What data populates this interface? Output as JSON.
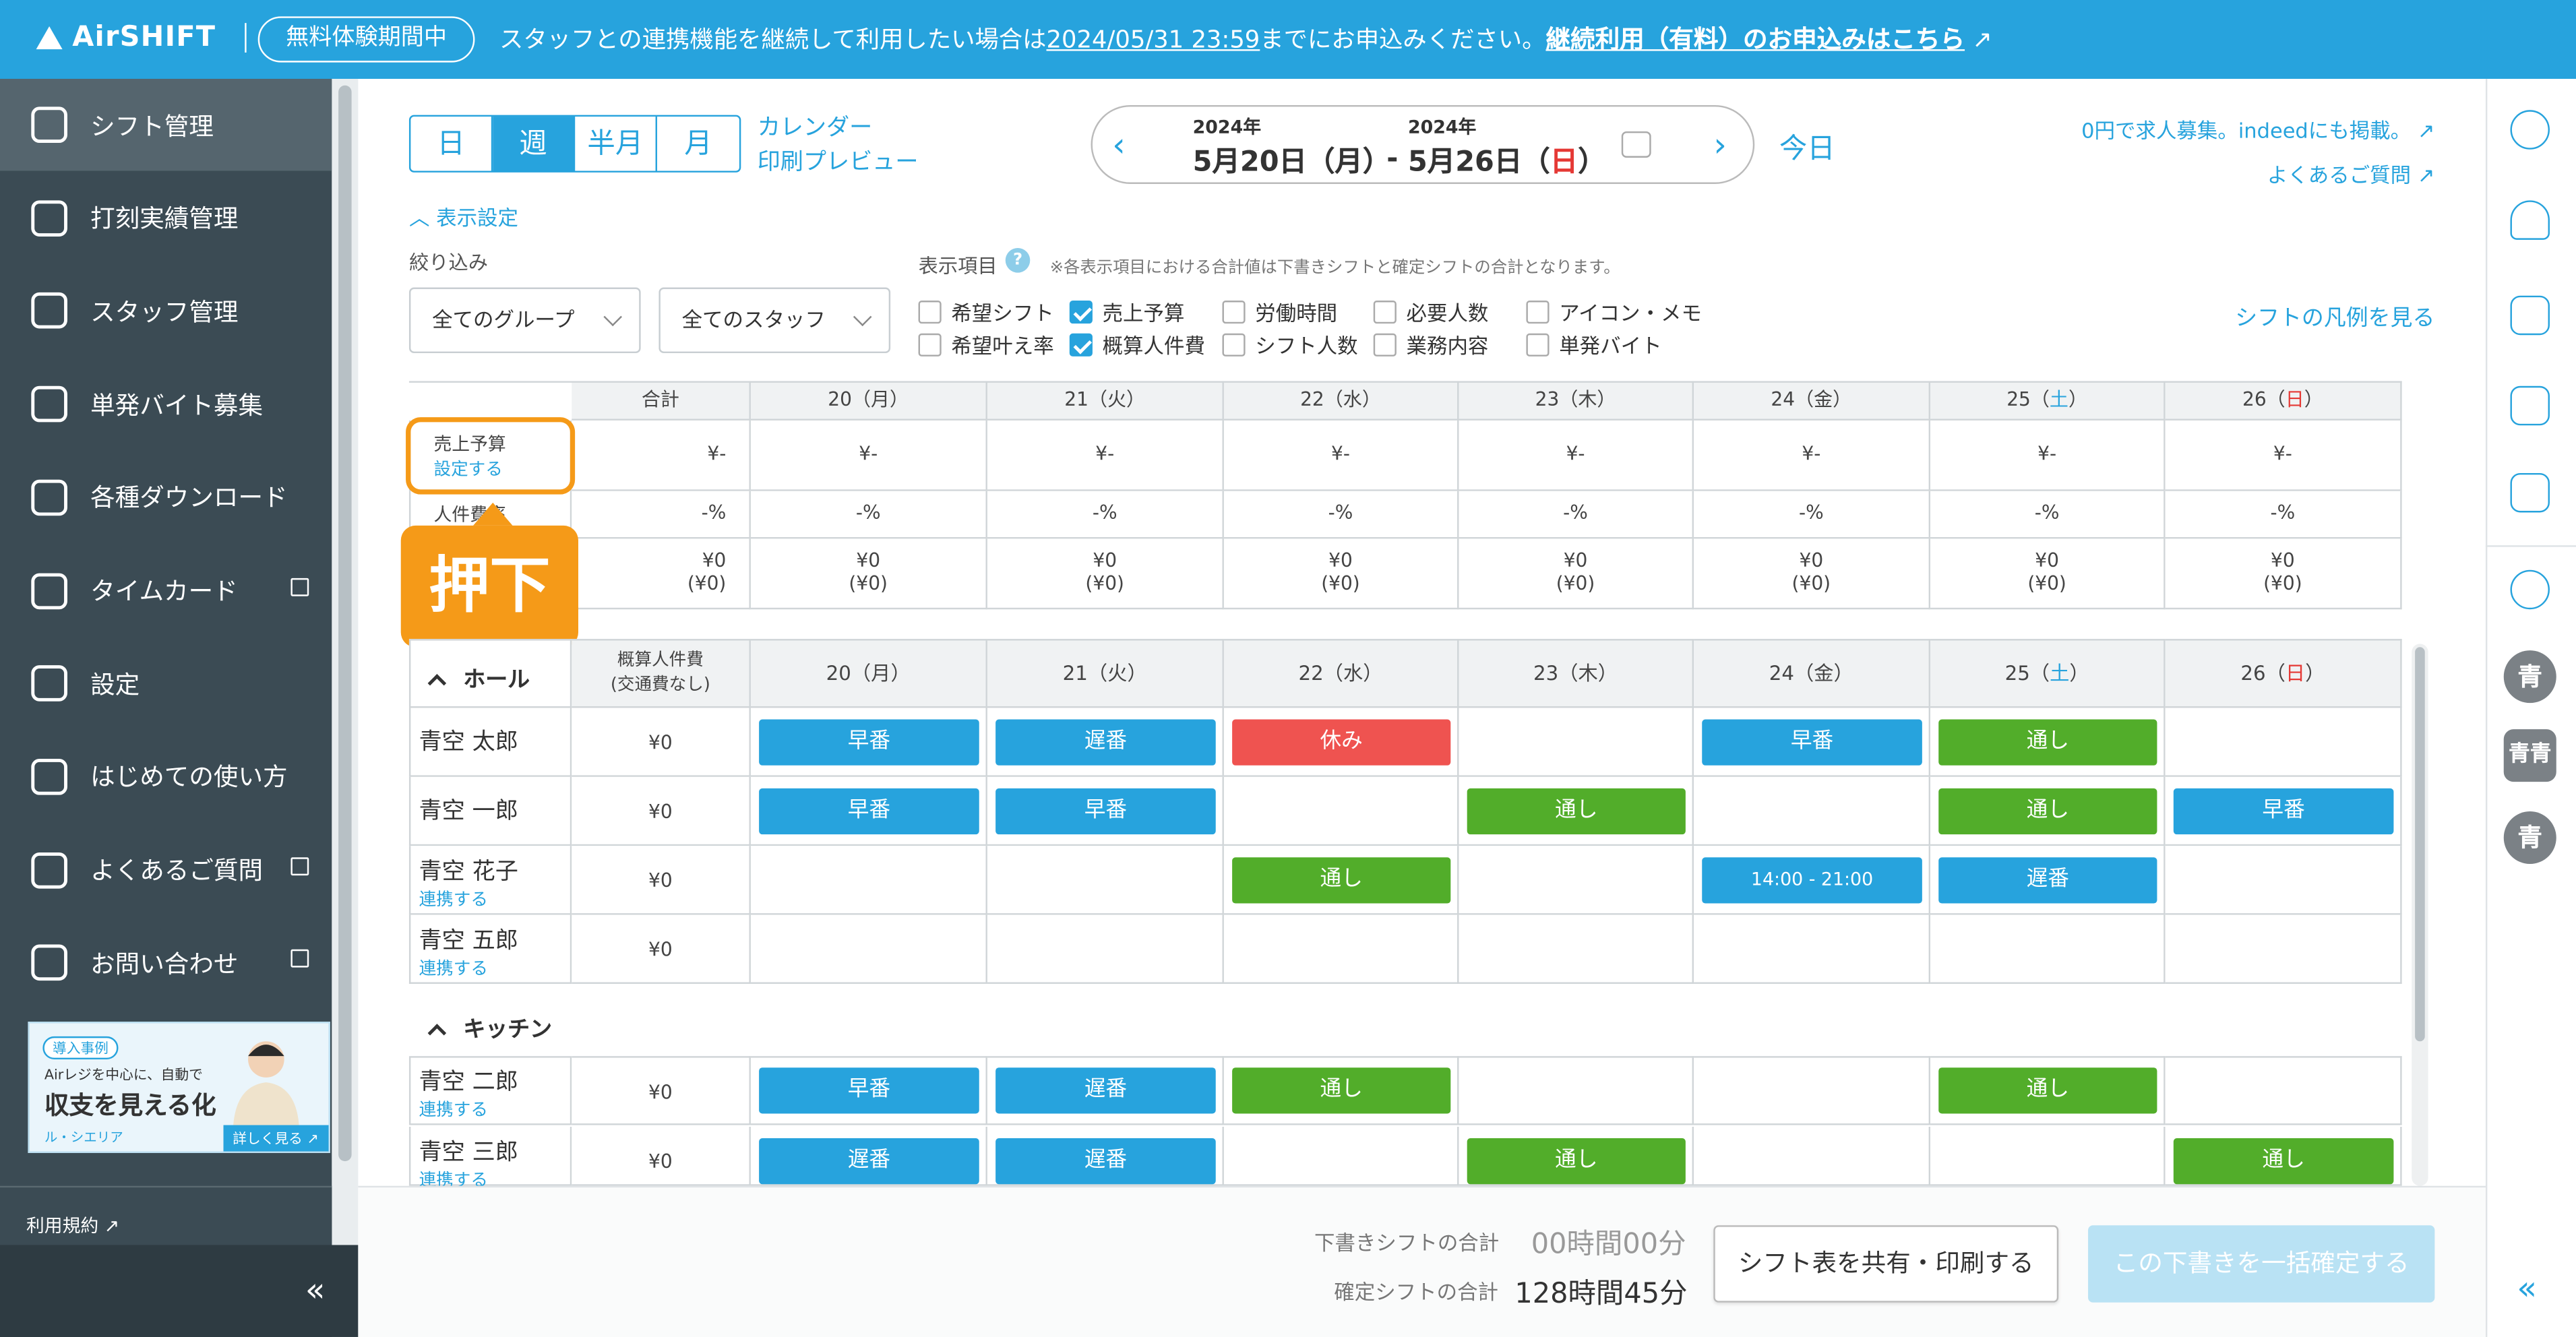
{
  "topbar": {
    "logo": "AirSHIFT",
    "trial": "無料体験期間中",
    "notice_pre": "スタッフとの連携機能を継続して利用したい場合は",
    "notice_date": "2024/05/31 23:59",
    "notice_post": "までにお申込みください。",
    "cta": "継続利用（有料）のお申込みはこちら"
  },
  "sidebar": {
    "items": [
      {
        "label": "シフト管理"
      },
      {
        "label": "打刻実績管理"
      },
      {
        "label": "スタッフ管理"
      },
      {
        "label": "単発バイト募集"
      },
      {
        "label": "各種ダウンロード"
      },
      {
        "label": "タイムカード"
      },
      {
        "label": "設定"
      },
      {
        "label": "はじめての使い方"
      },
      {
        "label": "よくあるご質問"
      },
      {
        "label": "お問い合わせ"
      }
    ],
    "banner": {
      "tag": "導入事例",
      "line1": "Airレジを中心に、自動で",
      "line2": "収支を見える化",
      "brand": "ル・シエリア",
      "more": "詳しく見る"
    },
    "terms": "利用規約",
    "collapse": "«"
  },
  "view": {
    "buttons": [
      "日",
      "週",
      "半月",
      "月"
    ],
    "calendar": "カレンダー",
    "print_preview": "印刷プレビュー"
  },
  "datenav": {
    "year1": "2024年",
    "date1": "5月20日（月）",
    "dash": "-",
    "year2": "2024年",
    "date2_pre": "5月26日（",
    "date2_sun": "日",
    "date2_post": "）",
    "prev": "‹",
    "next": "›"
  },
  "today": "今日",
  "links": {
    "indeed": "0円で求人募集。indeedにも掲載。",
    "faq": "よくあるご質問"
  },
  "display": {
    "toggle": "表示設定",
    "filter_label": "絞り込み",
    "group_select": "全てのグループ",
    "staff_select": "全てのスタッフ",
    "items_label": "表示項目",
    "note": "※各表示項目における合計値は下書きシフトと確定シフトの合計となります。",
    "legend": "シフトの凡例を見る",
    "checkboxes": [
      {
        "label": "希望シフト"
      },
      {
        "label": "売上予算"
      },
      {
        "label": "労働時間"
      },
      {
        "label": "必要人数"
      },
      {
        "label": "アイコン・メモ"
      },
      {
        "label": "希望叶え率"
      },
      {
        "label": "概算人件費"
      },
      {
        "label": "シフト人数"
      },
      {
        "label": "業務内容"
      },
      {
        "label": "単発バイト"
      }
    ]
  },
  "summary": {
    "header_total": "合計",
    "days": [
      {
        "d": "20（",
        "w": "月",
        "e": "）"
      },
      {
        "d": "21（",
        "w": "火",
        "e": "）"
      },
      {
        "d": "22（",
        "w": "水",
        "e": "）"
      },
      {
        "d": "23（",
        "w": "木",
        "e": "）"
      },
      {
        "d": "24（",
        "w": "金",
        "e": "）"
      },
      {
        "d": "25（",
        "w": "土",
        "e": "）"
      },
      {
        "d": "26（",
        "w": "日",
        "e": "）"
      }
    ],
    "row1_label": "売上予算",
    "row1_link": "設定する",
    "row1_val": "¥-",
    "row2_label": "人件費率",
    "row2_val": "-%",
    "row3_val": "¥0",
    "row3_sub": "(¥0)"
  },
  "callout": "押下",
  "shift": {
    "col_header1": "概算人件費",
    "col_header2": "(交通費なし)",
    "groups": [
      {
        "name": "ホール",
        "staff": [
          {
            "name": "青空 太郎",
            "link": "",
            "cost": "¥0",
            "shifts": [
              "早番",
              "遅番",
              "休み",
              "",
              "早番",
              "通し",
              ""
            ]
          },
          {
            "name": "青空 一郎",
            "link": "",
            "cost": "¥0",
            "shifts": [
              "早番",
              "早番",
              "",
              "通し",
              "",
              "通し",
              "早番"
            ]
          },
          {
            "name": "青空 花子",
            "link": "連携する",
            "cost": "¥0",
            "shifts": [
              "",
              "",
              "通し",
              "",
              "14:00 - 21:00",
              "遅番",
              ""
            ]
          },
          {
            "name": "青空 五郎",
            "link": "連携する",
            "cost": "¥0",
            "shifts": [
              "",
              "",
              "",
              "",
              "",
              "",
              ""
            ]
          }
        ]
      },
      {
        "name": "キッチン",
        "staff": [
          {
            "name": "青空 二郎",
            "link": "連携する",
            "cost": "¥0",
            "shifts": [
              "早番",
              "遅番",
              "通し",
              "",
              "",
              "通し",
              ""
            ]
          },
          {
            "name": "青空 三郎",
            "link": "連携する",
            "cost": "¥0",
            "shifts": [
              "遅番",
              "遅番",
              "",
              "通し",
              "",
              "",
              "通し"
            ]
          }
        ]
      }
    ]
  },
  "rightbar": {
    "avatars": [
      "青",
      "青青",
      "青"
    ]
  },
  "footer": {
    "draft_label": "下書きシフトの合計",
    "draft_value": "00時間00分",
    "confirmed_label": "確定シフトの合計",
    "confirmed_value": "128時間45分",
    "share": "シフト表を共有・印刷する",
    "confirm": "この下書きを一括確定する"
  },
  "colors": {
    "accent": "#27a3dd",
    "early": "#27a3dd",
    "full": "#52ad2a",
    "off": "#ef5350",
    "highlight": "#f59a18"
  }
}
